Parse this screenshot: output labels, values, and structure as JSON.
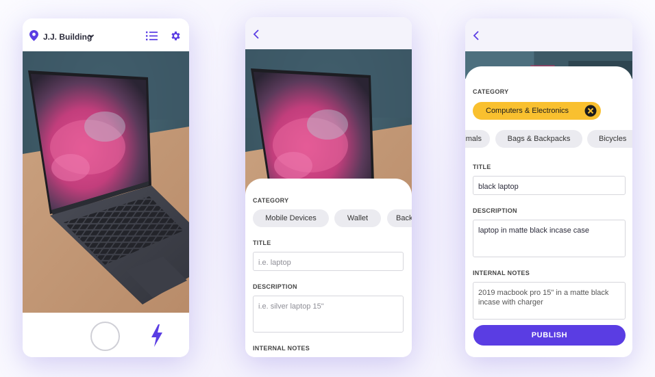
{
  "colors": {
    "accent_purple": "#5a3de3",
    "selected_chip_yellow": "#f9c02f",
    "chip_gray": "#ebebf0"
  },
  "camera_screen": {
    "location": "J.J. Building",
    "icons": [
      "location-pin-icon",
      "chevron-down-icon",
      "list-icon",
      "gear-icon",
      "flash-icon"
    ]
  },
  "form_empty": {
    "category_label": "CATEGORY",
    "categories": [
      "Mobile Devices",
      "Wallet",
      "Backpacks"
    ],
    "title_label": "TITLE",
    "title_placeholder": "i.e. laptop",
    "description_label": "DESCRIPTION",
    "description_placeholder": "i.e. silver laptop 15\"",
    "notes_label": "INTERNAL NOTES"
  },
  "form_filled": {
    "category_label": "CATEGORY",
    "selected_category": "Computers & Electronics",
    "categories": [
      "Animals",
      "Bags & Backpacks",
      "Bicycles"
    ],
    "title_label": "TITLE",
    "title_value": "black laptop",
    "description_label": "DESCRIPTION",
    "description_value": "laptop in matte black incase case",
    "notes_label": "INTERNAL NOTES",
    "notes_value": "2019 macbook pro 15\" in a matte black incase with charger",
    "publish_label": "PUBLISH"
  }
}
